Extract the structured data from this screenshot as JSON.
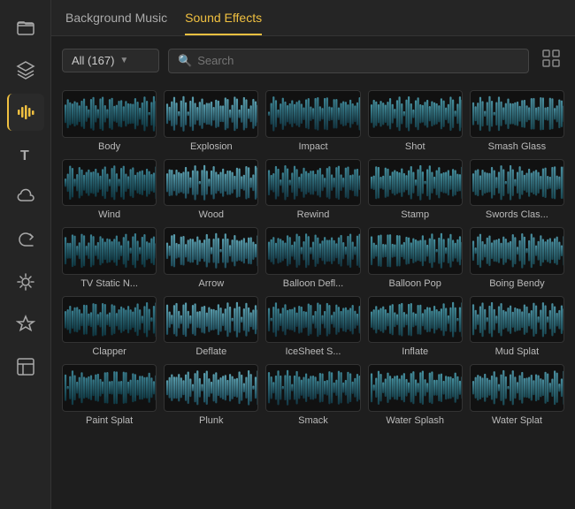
{
  "sidebar": {
    "items": [
      {
        "name": "folder-icon",
        "icon": "📁",
        "active": false
      },
      {
        "name": "layers-icon",
        "icon": "⊞",
        "active": false
      },
      {
        "name": "audio-icon",
        "icon": "📊",
        "active": true
      },
      {
        "name": "text-icon",
        "icon": "T",
        "active": false
      },
      {
        "name": "cloud-icon",
        "icon": "☁",
        "active": false
      },
      {
        "name": "arrow-icon",
        "icon": "↩",
        "active": false
      },
      {
        "name": "effect-icon",
        "icon": "✦",
        "active": false
      },
      {
        "name": "star-icon",
        "icon": "☆",
        "active": false
      },
      {
        "name": "layout-icon",
        "icon": "⊟",
        "active": false
      }
    ]
  },
  "tabs": [
    {
      "label": "Background Music",
      "active": false
    },
    {
      "label": "Sound Effects",
      "active": true
    }
  ],
  "controls": {
    "dropdown_label": "All (167)",
    "search_placeholder": "Search",
    "grid_toggle_icon": "⊞"
  },
  "sounds": [
    {
      "label": "Body"
    },
    {
      "label": "Explosion"
    },
    {
      "label": "Impact"
    },
    {
      "label": "Shot"
    },
    {
      "label": "Smash Glass"
    },
    {
      "label": "Wind"
    },
    {
      "label": "Wood"
    },
    {
      "label": "Rewind"
    },
    {
      "label": "Stamp"
    },
    {
      "label": "Swords Clas..."
    },
    {
      "label": "TV Static N..."
    },
    {
      "label": "Arrow"
    },
    {
      "label": "Balloon Defl..."
    },
    {
      "label": "Balloon Pop"
    },
    {
      "label": "Boing Bendy"
    },
    {
      "label": "Clapper"
    },
    {
      "label": "Deflate"
    },
    {
      "label": "IceSheet S..."
    },
    {
      "label": "Inflate"
    },
    {
      "label": "Mud Splat"
    },
    {
      "label": "Paint Splat"
    },
    {
      "label": "Plunk"
    },
    {
      "label": "Smack"
    },
    {
      "label": "Water Splash"
    },
    {
      "label": "Water Splat"
    }
  ]
}
